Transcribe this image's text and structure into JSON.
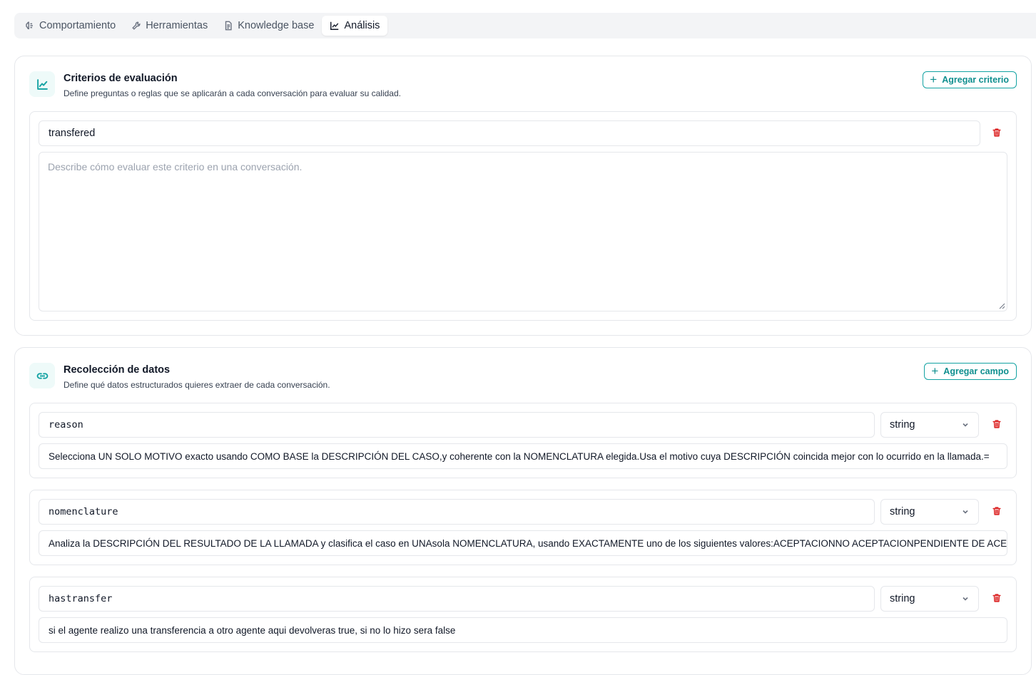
{
  "tabs": [
    {
      "label": "Comportamiento",
      "icon": "brain-icon"
    },
    {
      "label": "Herramientas",
      "icon": "wrench-icon"
    },
    {
      "label": "Knowledge base",
      "icon": "document-icon"
    },
    {
      "label": "Análisis",
      "icon": "chart-icon",
      "active": true
    }
  ],
  "criteria": {
    "title": "Criterios de evaluación",
    "description": "Define preguntas o reglas que se aplicarán a cada conversación para evaluar su calidad.",
    "add_label": "Agregar criterio",
    "items": [
      {
        "name": "transfered",
        "description_placeholder": "Describe cómo evaluar este criterio en una conversación."
      }
    ]
  },
  "data_collection": {
    "title": "Recolección de datos",
    "description": "Define qué datos estructurados quieres extraer de cada conversación.",
    "add_label": "Agregar campo",
    "fields": [
      {
        "name": "reason",
        "type": "string",
        "description": "Selecciona UN SOLO MOTIVO exacto usando COMO BASE la DESCRIPCIÓN DEL CASO,y coherente con la NOMENCLATURA elegida.Usa el motivo cuya DESCRIPCIÓN coincida mejor con lo ocurrido en la llamada.="
      },
      {
        "name": "nomenclature",
        "type": "string",
        "description": "Analiza la DESCRIPCIÓN DEL RESULTADO DE LA LLAMADA y clasifica el caso en UNAsola NOMENCLATURA, usando EXACTAMENTE uno de los siguientes valores:ACEPTACIONNO ACEPTACIONPENDIENTE DE ACEI"
      },
      {
        "name": "hastransfer",
        "type": "string",
        "description": "si el agente realizo una transferencia a otro agente aqui devolveras true, si no lo hizo sera false"
      }
    ]
  }
}
